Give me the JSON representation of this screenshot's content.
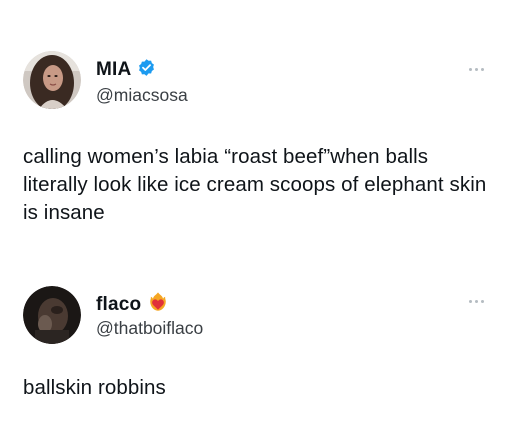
{
  "tweets": [
    {
      "display_name": "MIA",
      "handle": "@miacsosa",
      "verified": true,
      "verified_color": "#1d9bf0",
      "badge_icon": "verified-badge-icon",
      "text": "calling women’s labia “roast beef”when balls literally look like ice cream scoops of elephant skin is insane"
    },
    {
      "display_name": "flaco",
      "handle": "@thatboiflaco",
      "verified": false,
      "badge_icon": "heart-on-fire-icon",
      "text": "ballskin robbins"
    }
  ],
  "colors": {
    "text": "#0f1419",
    "handle": "#3a3f44",
    "more_dots": "#b5bcc2",
    "verified": "#1d9bf0",
    "heart": "#e0303a",
    "flame": "#f5a623"
  }
}
